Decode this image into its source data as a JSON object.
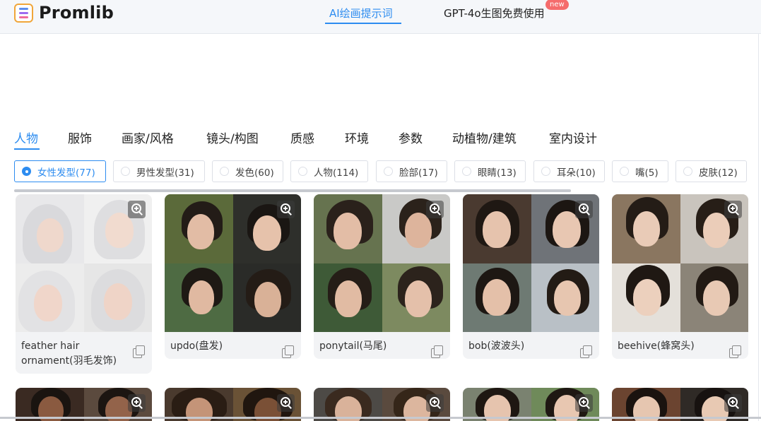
{
  "header": {
    "logo_text": "Promlib",
    "nav": [
      {
        "label": "AI绘画提示词",
        "active": true
      },
      {
        "label": "GPT-4o生图免费使用",
        "active": false,
        "badge": "new"
      }
    ]
  },
  "categories": [
    "人物",
    "服饰",
    "画家/风格",
    "镜头/构图",
    "质感",
    "环境",
    "参数",
    "动植物/建筑",
    "室内设计"
  ],
  "active_category": "人物",
  "subfilters": [
    "女性发型(77)",
    "男性发型(31)",
    "发色(60)",
    "人物(114)",
    "脸部(17)",
    "眼睛(13)",
    "耳朵(10)",
    "嘴(5)",
    "皮肤(12)"
  ],
  "active_subfilter": "女性发型(77)",
  "cards": [
    {
      "title": "feather hair ornament(羽毛发饰)"
    },
    {
      "title": "updo(盘发)"
    },
    {
      "title": "ponytail(马尾)"
    },
    {
      "title": "bob(波波头)"
    },
    {
      "title": "beehive(蜂窝头)"
    }
  ],
  "colors": {
    "accent": "#2d8cf0",
    "badge": "#f56c6c",
    "card_bg": "#f2f3f5"
  }
}
